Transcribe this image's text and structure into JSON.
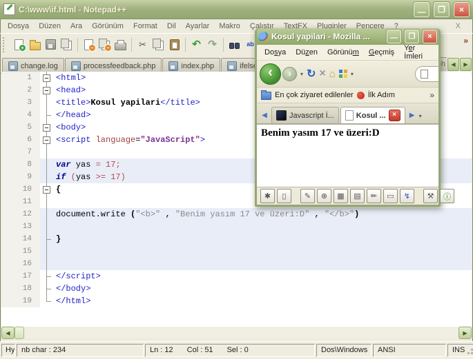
{
  "notepadpp": {
    "title": "C:\\www\\if.html - Notepad++",
    "menu": [
      "Dosya",
      "Düzen",
      "Ara",
      "Görünüm",
      "Format",
      "Dil",
      "Ayarlar",
      "Makro",
      "Çalıştır",
      "TextFX",
      "Pluginler",
      "Pencere",
      "?"
    ],
    "menu_close": "X",
    "toolbar": [
      {
        "name": "new-file",
        "kind": "page",
        "badge": "+",
        "badge_color": "#3F9E3F"
      },
      {
        "name": "open-folder",
        "kind": "folder"
      },
      {
        "name": "save",
        "kind": "floppy"
      },
      {
        "name": "save-all",
        "kind": "pages"
      },
      {
        "name": "close-file",
        "kind": "page",
        "badge": "−",
        "badge_color": "#E08828",
        "sep_before": true
      },
      {
        "name": "close-all",
        "kind": "pages",
        "badge": "−",
        "badge_color": "#E08828"
      },
      {
        "name": "print",
        "kind": "print"
      },
      {
        "name": "cut",
        "kind": "cut",
        "sep_before": true
      },
      {
        "name": "copy",
        "kind": "pages"
      },
      {
        "name": "paste",
        "kind": "paste"
      },
      {
        "name": "undo",
        "kind": "undo",
        "sep_before": true
      },
      {
        "name": "redo",
        "kind": "redo"
      },
      {
        "name": "find",
        "kind": "find",
        "sep_before": true
      },
      {
        "name": "replace",
        "kind": "replace"
      }
    ],
    "tabs": [
      {
        "label": "change.log"
      },
      {
        "label": "processfeedback.php"
      },
      {
        "label": "index.php"
      },
      {
        "label": "ifelse.php"
      }
    ],
    "tab_overflow_fragment": "x.ph",
    "editor": {
      "lines": [
        {
          "n": "1",
          "fold": "box",
          "hl": false,
          "segs": [
            [
              "tag",
              "<html>"
            ]
          ]
        },
        {
          "n": "2",
          "fold": "box",
          "hl": false,
          "segs": [
            [
              "tag",
              "<head>"
            ]
          ]
        },
        {
          "n": "3",
          "fold": "line",
          "hl": false,
          "segs": [
            [
              "tag",
              "<title>"
            ],
            [
              "b",
              "Kosul yapilari"
            ],
            [
              "tag",
              "</title>"
            ]
          ]
        },
        {
          "n": "4",
          "fold": "tick",
          "hl": false,
          "segs": [
            [
              "tag",
              "</head>"
            ]
          ]
        },
        {
          "n": "5",
          "fold": "box",
          "hl": false,
          "segs": [
            [
              "tag",
              "<body>"
            ]
          ]
        },
        {
          "n": "6",
          "fold": "box",
          "hl": false,
          "segs": [
            [
              "tag",
              "<script "
            ],
            [
              "attr",
              "language"
            ],
            [
              "p",
              "="
            ],
            [
              "aval",
              "\"JavaScript\""
            ],
            [
              "tag",
              ">"
            ]
          ]
        },
        {
          "n": "7",
          "fold": "line",
          "hl": false,
          "segs": []
        },
        {
          "n": "8",
          "fold": "line",
          "hl": true,
          "segs": [
            [
              "kw",
              "var"
            ],
            [
              "p",
              " yas "
            ],
            [
              "op",
              "= "
            ],
            [
              "num",
              "17"
            ],
            [
              "op",
              ";"
            ]
          ]
        },
        {
          "n": "9",
          "fold": "line",
          "hl": true,
          "segs": [
            [
              "kw",
              "if"
            ],
            [
              "p",
              " "
            ],
            [
              "op",
              "("
            ],
            [
              "p",
              "yas "
            ],
            [
              "op",
              ">= "
            ],
            [
              "num",
              "17"
            ],
            [
              "op",
              ")"
            ]
          ]
        },
        {
          "n": "10",
          "fold": "box",
          "hl": false,
          "segs": [
            [
              "pb",
              "{"
            ]
          ]
        },
        {
          "n": "11",
          "fold": "line",
          "hl": false,
          "segs": []
        },
        {
          "n": "12",
          "fold": "line",
          "hl": true,
          "segs": [
            [
              "p",
              "document.write "
            ],
            [
              "pb",
              "("
            ],
            [
              "str",
              "\"<b>\""
            ],
            [
              "p",
              " , "
            ],
            [
              "str",
              "\"Benim yasım 17 ve üzeri:D\""
            ],
            [
              "p",
              " , "
            ],
            [
              "str",
              "\"</b>\""
            ],
            [
              "pb",
              ")"
            ]
          ]
        },
        {
          "n": "13",
          "fold": "line",
          "hl": true,
          "segs": []
        },
        {
          "n": "14",
          "fold": "tick",
          "hl": true,
          "segs": [
            [
              "pb",
              "}"
            ]
          ]
        },
        {
          "n": "15",
          "fold": "line",
          "hl": true,
          "segs": []
        },
        {
          "n": "16",
          "fold": "line",
          "hl": true,
          "segs": []
        },
        {
          "n": "17",
          "fold": "tick",
          "hl": false,
          "segs": [
            [
              "tag",
              "</script>"
            ]
          ]
        },
        {
          "n": "18",
          "fold": "tick",
          "hl": false,
          "segs": [
            [
              "tag",
              "</body>"
            ]
          ]
        },
        {
          "n": "19",
          "fold": "end",
          "hl": false,
          "segs": [
            [
              "tag",
              "</html>"
            ]
          ]
        }
      ]
    },
    "statusbar": {
      "doctype": "Hype",
      "nbchar": "nb char : 234",
      "ln": "Ln : 12",
      "col": "Col : 51",
      "sel": "Sel : 0",
      "eol": "Dos\\Windows",
      "enc": "ANSI",
      "ins": "INS"
    }
  },
  "firefox": {
    "title": "Kosul yapilari - Mozilla ...",
    "menu": [
      {
        "label": "Dosya",
        "accel": 2
      },
      {
        "label": "Düzen",
        "accel": 2
      },
      {
        "label": "Görünüm",
        "accel": 6
      },
      {
        "label": "Geçmiş",
        "accel": 0
      },
      {
        "label": "Yer İmleri",
        "accel": 1
      }
    ],
    "bookmarks": [
      {
        "label": "En çok ziyaret edilenler"
      },
      {
        "label": "İlk Adım"
      }
    ],
    "bookmarks_overflow": "»",
    "tabs": [
      {
        "label": "Javascript İ...",
        "icon": "dark",
        "active": false
      },
      {
        "label": "Kosul ...",
        "icon": "page",
        "active": true,
        "close": "×"
      }
    ],
    "content": "Benim yasım 17 ve üzeri:D",
    "statusbar_icons": [
      {
        "name": "firebug-icon",
        "glyph": "✱"
      },
      {
        "name": "new-doc-icon",
        "glyph": "▯"
      },
      {
        "name": "edit-pen-icon",
        "glyph": "✎",
        "gap_before": true
      },
      {
        "name": "globe-icon",
        "glyph": "⊕"
      },
      {
        "name": "save-page-icon",
        "glyph": "▦"
      },
      {
        "name": "print-page-icon",
        "glyph": "▤"
      },
      {
        "name": "compose-icon",
        "glyph": "✏"
      },
      {
        "name": "panel-icon",
        "glyph": "▭"
      },
      {
        "name": "lightning-icon",
        "glyph": "↯",
        "color": "#2255CC"
      },
      {
        "name": "tools-icon",
        "glyph": "⚒",
        "gap_before": true
      },
      {
        "name": "info-icon",
        "glyph": "ⓘ",
        "color": "#2E8B2E"
      }
    ]
  }
}
